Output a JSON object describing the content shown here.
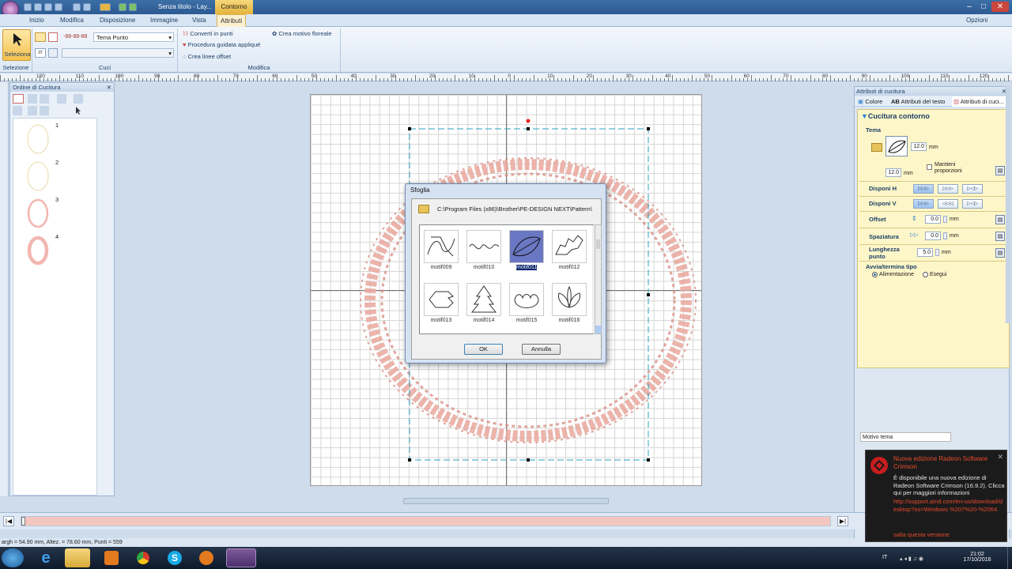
{
  "window": {
    "title": "Senza titolo - Lay...",
    "context_tab": "Contorno"
  },
  "tabs": [
    {
      "label": "Inizio"
    },
    {
      "label": "Modifica"
    },
    {
      "label": "Disposizione"
    },
    {
      "label": "Immagine"
    },
    {
      "label": "Vista"
    },
    {
      "label": "Attributi"
    }
  ],
  "options_label": "Opzioni",
  "ribbon": {
    "select_label": "Seleziona",
    "group_select": "Selezione",
    "group_stitch": "Cuci",
    "group_modify": "Modifica",
    "stitch_combo": "Tema Punto",
    "convert": "Converti in punti",
    "applique": "Procedura guidata appliqué",
    "offset_lines": "Crea linee offset",
    "floral": "Crea motivo floreale"
  },
  "ruler_labels": [
    "120",
    "110",
    "100",
    "90",
    "80",
    "70",
    "60",
    "50",
    "40",
    "30",
    "20",
    "10",
    "0",
    "10",
    "20",
    "30",
    "40",
    "50",
    "60",
    "70",
    "80",
    "90",
    "100",
    "110",
    "120"
  ],
  "left_panel": {
    "title": "Ordine di Cucitura",
    "items": [
      "1",
      "2",
      "3",
      "4"
    ]
  },
  "dialog": {
    "title": "Sfoglia",
    "path": "C:\\Program Files (x86)\\Brother\\PE-DESIGN NEXT\\Pattern\\",
    "motifs": [
      "motif009",
      "motif010",
      "motif011",
      "motif012",
      "motif013",
      "motif014",
      "motif015",
      "motif016"
    ],
    "selected": "motif011",
    "ok": "OK",
    "cancel": "Annulla"
  },
  "right_panel": {
    "title": "Attributi di cucitura",
    "tabs": [
      "Colore",
      "Attributi del testo",
      "Attributi di cuci..."
    ],
    "section": "Cucitura contorno",
    "tema": "Tema",
    "width": "12.0",
    "height": "12.0",
    "unit": "mm",
    "keep_ratio": "Mantieni proporzioni",
    "disponi_h": "Disponi H",
    "disponi_v": "Disponi V",
    "offset_label": "Offset",
    "offset_val": "0.0",
    "spacing_label": "Spaziatura",
    "spacing_val": "0.0",
    "length_label": "Lunghezza punto",
    "length_val": "5.0",
    "start_end": "Avvia/termina tipo",
    "radio1": "Alimentazione",
    "radio2": "Esegui"
  },
  "tooltip": "Motivo tema",
  "toast": {
    "title": "Nuova edizione Radeon Software Crimson",
    "body": "È disponibile una nuova edizione di Radeon Software Crimson (16.9.2). Clicca qui per maggiori informazioni",
    "link": "http://support.amd.com/en-us/download/desktop?os=Windows %207%20-%2064.",
    "skip": "salta questa versione"
  },
  "status": "argh = 54.90 mm, Altez. = 78.60 mm, Punti = 559",
  "clock": {
    "time": "21:02",
    "date": "17/10/2016",
    "lang": "IT"
  }
}
